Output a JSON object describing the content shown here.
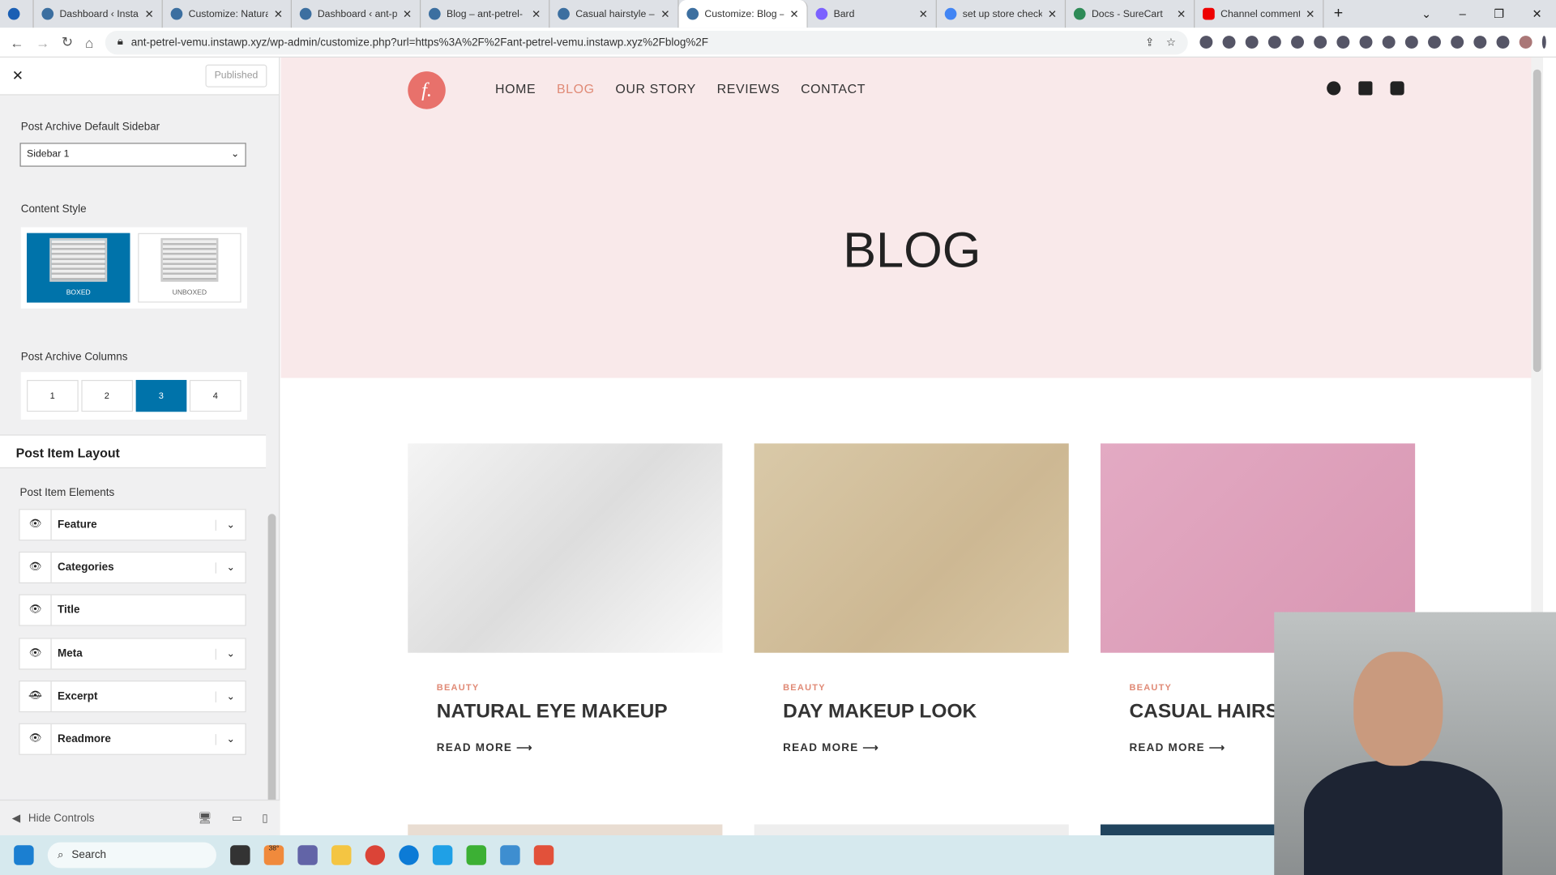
{
  "browser": {
    "tabs": [
      {
        "title": "Dashboard ‹ Insta"
      },
      {
        "title": "Customize: Natura"
      },
      {
        "title": "Dashboard ‹ ant-p"
      },
      {
        "title": "Blog – ant-petrel-"
      },
      {
        "title": "Casual hairstyle –"
      },
      {
        "title": "Customize: Blog –"
      },
      {
        "title": "Bard"
      },
      {
        "title": "set up store check"
      },
      {
        "title": "Docs - SureCart"
      },
      {
        "title": "Channel comment"
      }
    ],
    "active_tab": 5,
    "url": "ant-petrel-vemu.instawp.xyz/wp-admin/customize.php?url=https%3A%2F%2Fant-petrel-vemu.instawp.xyz%2Fblog%2F"
  },
  "customizer": {
    "status": "Published",
    "sidebar_label": "Post Archive Default Sidebar",
    "sidebar_value": "Sidebar 1",
    "content_style_label": "Content Style",
    "styles": [
      {
        "label": "BOXED",
        "selected": true
      },
      {
        "label": "UNBOXED",
        "selected": false
      }
    ],
    "columns_label": "Post Archive Columns",
    "columns": [
      "1",
      "2",
      "3",
      "4"
    ],
    "selected_column": "3",
    "section_title": "Post Item Layout",
    "elements_label": "Post Item Elements",
    "elements": [
      {
        "label": "Feature",
        "visible": true,
        "expandable": true
      },
      {
        "label": "Categories",
        "visible": true,
        "expandable": true
      },
      {
        "label": "Title",
        "visible": true,
        "expandable": false
      },
      {
        "label": "Meta",
        "visible": true,
        "expandable": true
      },
      {
        "label": "Excerpt",
        "visible": false,
        "expandable": true
      },
      {
        "label": "Readmore",
        "visible": true,
        "expandable": true
      }
    ],
    "hide_controls": "Hide Controls"
  },
  "site": {
    "logo": "f.",
    "nav": [
      "HOME",
      "BLOG",
      "OUR STORY",
      "REVIEWS",
      "CONTACT"
    ],
    "current_nav": "BLOG",
    "page_title": "BLOG",
    "posts": [
      {
        "category": "BEAUTY",
        "title": "NATURAL EYE MAKEUP",
        "read_more": "READ MORE ⟶"
      },
      {
        "category": "BEAUTY",
        "title": "DAY MAKEUP LOOK",
        "read_more": "READ MORE ⟶"
      },
      {
        "category": "BEAUTY",
        "title": "CASUAL HAIRSTYLE",
        "read_more": "READ MORE ⟶"
      }
    ],
    "accent": "#e08a76"
  },
  "taskbar": {
    "search_placeholder": "Search",
    "weather": "38°"
  }
}
